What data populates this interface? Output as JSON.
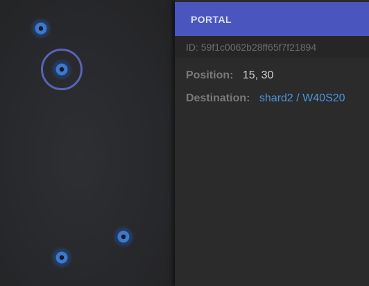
{
  "panel": {
    "title": "PORTAL",
    "id_text": "ID: 59f1c0062b28ff65f7f21894",
    "position_label": "Position:",
    "position_value": "15, 30",
    "destination_label": "Destination:",
    "destination_value": "shard2 / W40S20"
  },
  "colors": {
    "header": "#4a55be",
    "link": "#4b96db",
    "selection": "#5a63b8",
    "portal": "#3f79c6"
  }
}
